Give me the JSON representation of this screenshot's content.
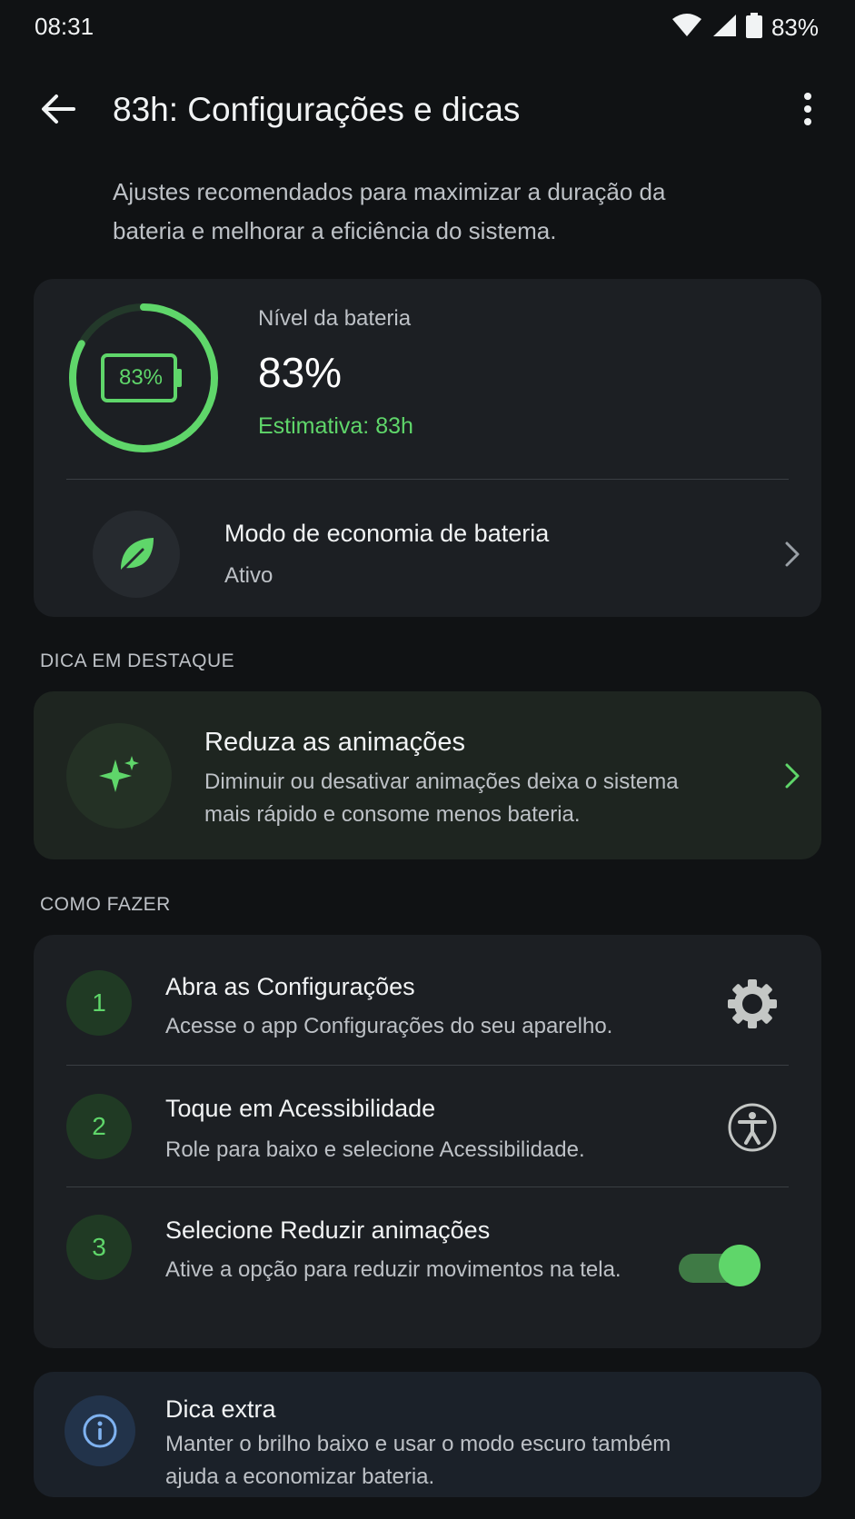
{
  "status_bar": {
    "time": "08:31",
    "battery_percent": "83%",
    "icons": [
      "wifi-icon",
      "cell-signal-icon",
      "battery-icon"
    ]
  },
  "app_bar": {
    "title": "83h: Configurações e dicas",
    "back_icon": "arrow-left-icon",
    "menu_icon": "more-vert-icon"
  },
  "intro": "Ajustes recomendados para maximizar a duração da bateria e melhorar a eficiência do sistema.",
  "battery": {
    "label": "Nível da bateria",
    "value": "83%",
    "ring_text": "83%",
    "level_fraction": 0.83,
    "estimate": "Estimativa: 83h",
    "accent_color": "#5fd66a"
  },
  "eco_mode": {
    "title": "Modo de economia de bateria",
    "status": "Ativo",
    "icon": "leaf-icon"
  },
  "featured": {
    "section_label": "DICA EM DESTAQUE",
    "title": "Reduza as animações",
    "description": "Diminuir ou desativar animações deixa o sistema mais rápido e consome menos bateria.",
    "icon": "sparkle-icon"
  },
  "how_to": {
    "section_label": "COMO FAZER",
    "steps": [
      {
        "number": "1",
        "title": "Abra as Configurações",
        "description": "Acesse o app Configurações do seu aparelho.",
        "icon": "gear-icon"
      },
      {
        "number": "2",
        "title": "Toque em Acessibilidade",
        "description": "Role para baixo e selecione Acessibilidade.",
        "icon": "accessibility-icon"
      },
      {
        "number": "3",
        "title": "Selecione Reduzir animações",
        "description": "Ative a opção para reduzir movimentos na tela.",
        "toggle_on": true
      }
    ]
  },
  "extra_tip": {
    "title": "Dica extra",
    "description": "Manter o brilho baixo e usar o modo escuro também ajuda a economizar bateria.",
    "icon": "info-icon"
  }
}
